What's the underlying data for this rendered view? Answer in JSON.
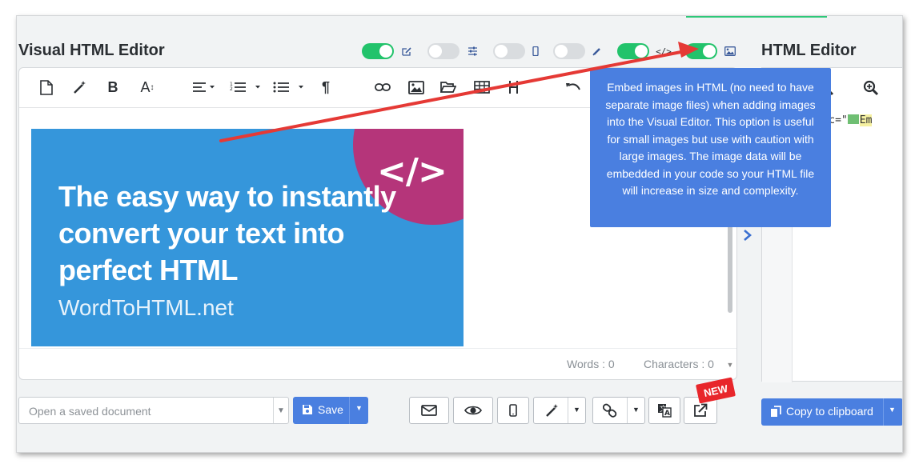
{
  "header": {
    "visual_title": "Visual HTML Editor",
    "html_title": "HTML Editor"
  },
  "toggles": [
    {
      "state": "on",
      "icon": "edit-icon"
    },
    {
      "state": "off",
      "icon": "sliders-icon"
    },
    {
      "state": "off",
      "icon": "mobile-icon"
    },
    {
      "state": "off",
      "icon": "pencil-icon"
    },
    {
      "state": "on",
      "icon": "code-icon",
      "icon_text": "</>"
    },
    {
      "state": "on",
      "icon": "image-icon"
    }
  ],
  "toolbar": {
    "bold_label": "B",
    "font_size_label": "A",
    "font_size_sub": "↕",
    "paragraph_label": "¶"
  },
  "banner": {
    "code_symbol": "</>",
    "headline": "The easy way to instantly convert your text into perfect HTML",
    "site": "WordToHTML.net"
  },
  "status": {
    "words": "Words : 0",
    "characters": "Characters : 0"
  },
  "tooltip": {
    "text": "Embed images in HTML (no need to have separate image files) when adding images into the Visual Editor. This option is useful for small images but use with caution with large images. The image data will be embedded in your code so your HTML file will increase in size and complexity."
  },
  "code_panel": {
    "snippet_prefix": "g src=\"",
    "snippet_suffix": "Em"
  },
  "bottom": {
    "saved_doc_placeholder": "Open a saved document",
    "save_label": "Save",
    "copy_label": "Copy to clipboard",
    "new_badge": "NEW"
  },
  "colors": {
    "accent": "#4a7fe0",
    "toggle_on": "#22c36b",
    "banner_bg": "#3596db",
    "banner_circle": "#b5357a",
    "arrow": "#e53935"
  }
}
